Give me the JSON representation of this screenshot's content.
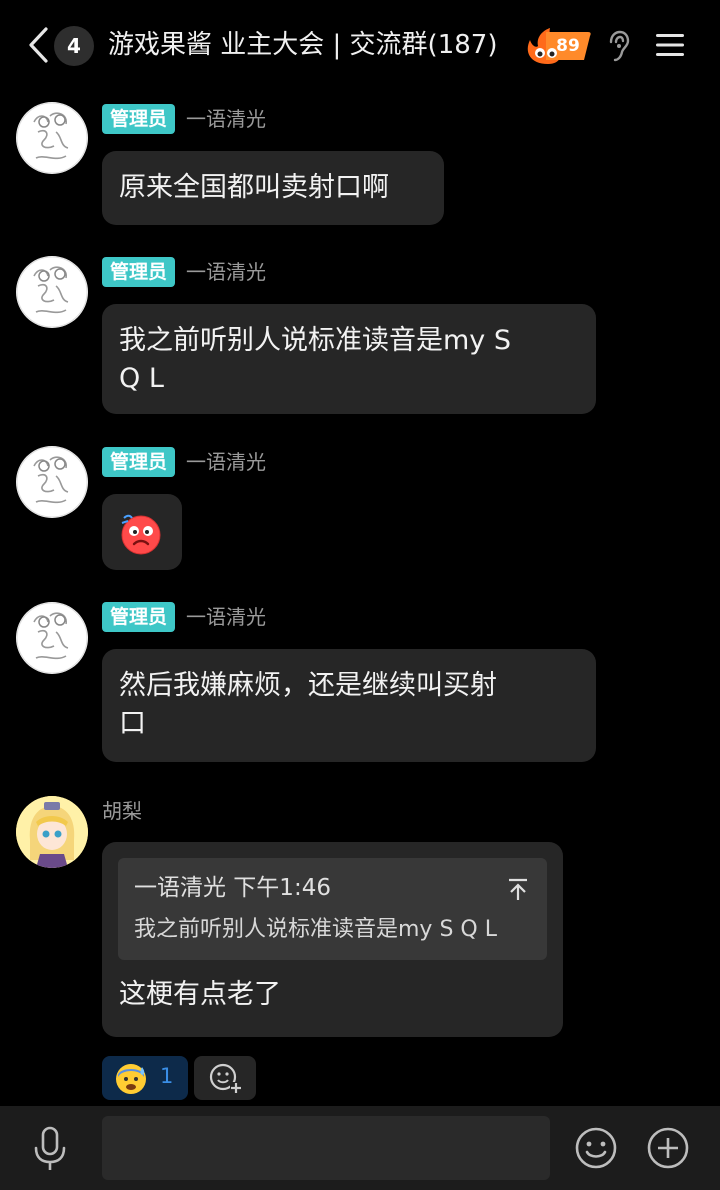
{
  "header": {
    "unread_count": "4",
    "title": "游戏果酱 业主大会 | 交流群(187)",
    "fire_level": "89"
  },
  "messages": [
    {
      "role_tag": "管理员",
      "sender": "一语清光",
      "text": "原来全国都叫卖射口啊"
    },
    {
      "role_tag": "管理员",
      "sender": "一语清光",
      "text_line1": "我之前听别人说标准读音是my S",
      "text_line2": "Q L"
    },
    {
      "role_tag": "管理员",
      "sender": "一语清光",
      "sticker": "dizzy-face-sticker"
    },
    {
      "role_tag": "管理员",
      "sender": "一语清光",
      "text_line1": "然后我嫌麻烦，还是继续叫买射",
      "text_line2": "口"
    },
    {
      "sender": "胡梨",
      "quote_head": "一语清光 下午1:46",
      "quote_text": "我之前听别人说标准读音是my S Q L",
      "text": "这梗有点老了",
      "reaction_emoji": "anxious-sweat-emoji",
      "reaction_count": "1"
    }
  ],
  "input_bar": {
    "placeholder": ""
  },
  "colors": {
    "background": "#000000",
    "bubble": "#262626",
    "role_tag": "#3ec7c7",
    "fire_orange": "#ff7a1a",
    "reaction_bg": "#0d2a4a"
  }
}
